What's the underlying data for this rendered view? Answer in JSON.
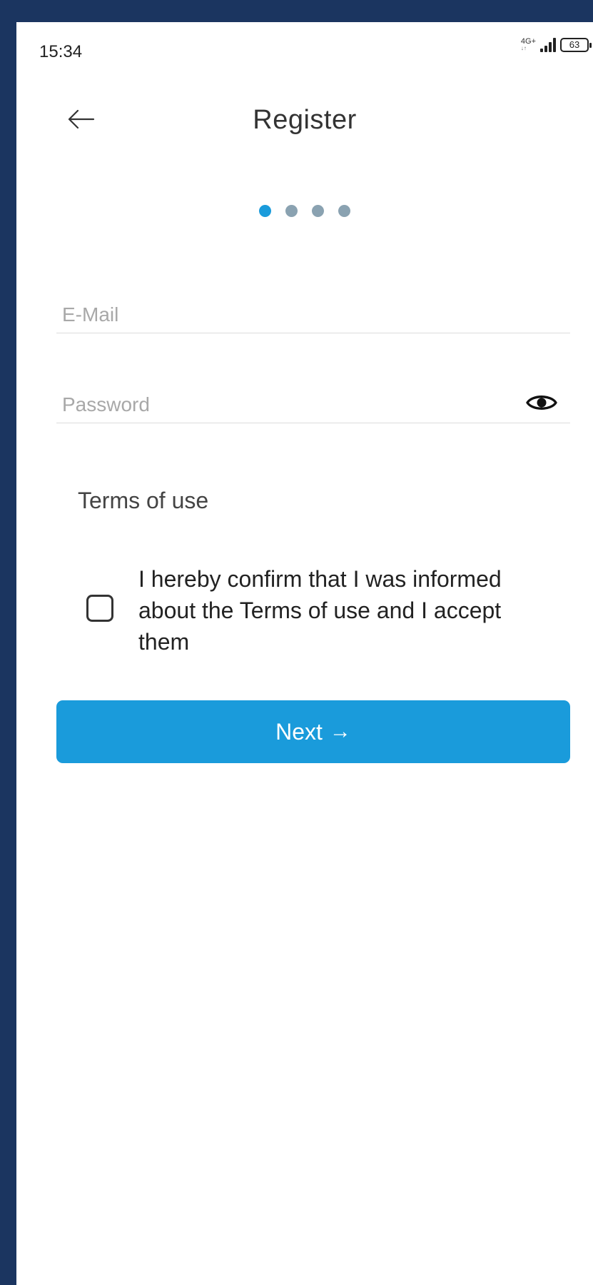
{
  "status_bar": {
    "time": "15:34",
    "network": "4G+",
    "network_sub": "↓↑",
    "battery": "63"
  },
  "header": {
    "title": "Register",
    "back_icon": "arrow-left-icon"
  },
  "steps": {
    "total": 4,
    "current": 1
  },
  "form": {
    "email_placeholder": "E-Mail",
    "email_value": "",
    "password_placeholder": "Password",
    "password_value": "",
    "visibility_icon": "eye-icon"
  },
  "terms": {
    "heading": "Terms of use",
    "checkbox_checked": false,
    "confirm_text": "I hereby confirm that I was informed about the Terms of use and I accept them"
  },
  "actions": {
    "next_label": "Next",
    "next_arrow": "→"
  },
  "colors": {
    "accent": "#1a9bdb",
    "dot_inactive": "#8aa2b1",
    "frame": "#1b3560"
  }
}
